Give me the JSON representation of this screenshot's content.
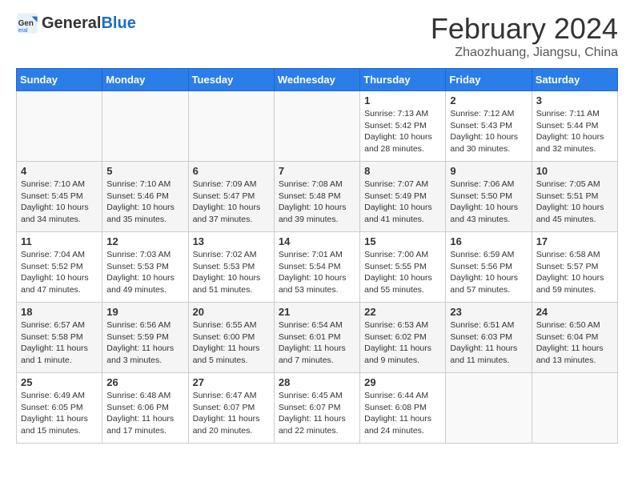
{
  "header": {
    "logo_general": "General",
    "logo_blue": "Blue",
    "month_title": "February 2024",
    "location": "Zhaozhuang, Jiangsu, China"
  },
  "days_of_week": [
    "Sunday",
    "Monday",
    "Tuesday",
    "Wednesday",
    "Thursday",
    "Friday",
    "Saturday"
  ],
  "weeks": [
    [
      {
        "day": "",
        "sunrise": "",
        "sunset": "",
        "daylight": ""
      },
      {
        "day": "",
        "sunrise": "",
        "sunset": "",
        "daylight": ""
      },
      {
        "day": "",
        "sunrise": "",
        "sunset": "",
        "daylight": ""
      },
      {
        "day": "",
        "sunrise": "",
        "sunset": "",
        "daylight": ""
      },
      {
        "day": "1",
        "sunrise": "Sunrise: 7:13 AM",
        "sunset": "Sunset: 5:42 PM",
        "daylight": "Daylight: 10 hours and 28 minutes."
      },
      {
        "day": "2",
        "sunrise": "Sunrise: 7:12 AM",
        "sunset": "Sunset: 5:43 PM",
        "daylight": "Daylight: 10 hours and 30 minutes."
      },
      {
        "day": "3",
        "sunrise": "Sunrise: 7:11 AM",
        "sunset": "Sunset: 5:44 PM",
        "daylight": "Daylight: 10 hours and 32 minutes."
      }
    ],
    [
      {
        "day": "4",
        "sunrise": "Sunrise: 7:10 AM",
        "sunset": "Sunset: 5:45 PM",
        "daylight": "Daylight: 10 hours and 34 minutes."
      },
      {
        "day": "5",
        "sunrise": "Sunrise: 7:10 AM",
        "sunset": "Sunset: 5:46 PM",
        "daylight": "Daylight: 10 hours and 35 minutes."
      },
      {
        "day": "6",
        "sunrise": "Sunrise: 7:09 AM",
        "sunset": "Sunset: 5:47 PM",
        "daylight": "Daylight: 10 hours and 37 minutes."
      },
      {
        "day": "7",
        "sunrise": "Sunrise: 7:08 AM",
        "sunset": "Sunset: 5:48 PM",
        "daylight": "Daylight: 10 hours and 39 minutes."
      },
      {
        "day": "8",
        "sunrise": "Sunrise: 7:07 AM",
        "sunset": "Sunset: 5:49 PM",
        "daylight": "Daylight: 10 hours and 41 minutes."
      },
      {
        "day": "9",
        "sunrise": "Sunrise: 7:06 AM",
        "sunset": "Sunset: 5:50 PM",
        "daylight": "Daylight: 10 hours and 43 minutes."
      },
      {
        "day": "10",
        "sunrise": "Sunrise: 7:05 AM",
        "sunset": "Sunset: 5:51 PM",
        "daylight": "Daylight: 10 hours and 45 minutes."
      }
    ],
    [
      {
        "day": "11",
        "sunrise": "Sunrise: 7:04 AM",
        "sunset": "Sunset: 5:52 PM",
        "daylight": "Daylight: 10 hours and 47 minutes."
      },
      {
        "day": "12",
        "sunrise": "Sunrise: 7:03 AM",
        "sunset": "Sunset: 5:53 PM",
        "daylight": "Daylight: 10 hours and 49 minutes."
      },
      {
        "day": "13",
        "sunrise": "Sunrise: 7:02 AM",
        "sunset": "Sunset: 5:53 PM",
        "daylight": "Daylight: 10 hours and 51 minutes."
      },
      {
        "day": "14",
        "sunrise": "Sunrise: 7:01 AM",
        "sunset": "Sunset: 5:54 PM",
        "daylight": "Daylight: 10 hours and 53 minutes."
      },
      {
        "day": "15",
        "sunrise": "Sunrise: 7:00 AM",
        "sunset": "Sunset: 5:55 PM",
        "daylight": "Daylight: 10 hours and 55 minutes."
      },
      {
        "day": "16",
        "sunrise": "Sunrise: 6:59 AM",
        "sunset": "Sunset: 5:56 PM",
        "daylight": "Daylight: 10 hours and 57 minutes."
      },
      {
        "day": "17",
        "sunrise": "Sunrise: 6:58 AM",
        "sunset": "Sunset: 5:57 PM",
        "daylight": "Daylight: 10 hours and 59 minutes."
      }
    ],
    [
      {
        "day": "18",
        "sunrise": "Sunrise: 6:57 AM",
        "sunset": "Sunset: 5:58 PM",
        "daylight": "Daylight: 11 hours and 1 minute."
      },
      {
        "day": "19",
        "sunrise": "Sunrise: 6:56 AM",
        "sunset": "Sunset: 5:59 PM",
        "daylight": "Daylight: 11 hours and 3 minutes."
      },
      {
        "day": "20",
        "sunrise": "Sunrise: 6:55 AM",
        "sunset": "Sunset: 6:00 PM",
        "daylight": "Daylight: 11 hours and 5 minutes."
      },
      {
        "day": "21",
        "sunrise": "Sunrise: 6:54 AM",
        "sunset": "Sunset: 6:01 PM",
        "daylight": "Daylight: 11 hours and 7 minutes."
      },
      {
        "day": "22",
        "sunrise": "Sunrise: 6:53 AM",
        "sunset": "Sunset: 6:02 PM",
        "daylight": "Daylight: 11 hours and 9 minutes."
      },
      {
        "day": "23",
        "sunrise": "Sunrise: 6:51 AM",
        "sunset": "Sunset: 6:03 PM",
        "daylight": "Daylight: 11 hours and 11 minutes."
      },
      {
        "day": "24",
        "sunrise": "Sunrise: 6:50 AM",
        "sunset": "Sunset: 6:04 PM",
        "daylight": "Daylight: 11 hours and 13 minutes."
      }
    ],
    [
      {
        "day": "25",
        "sunrise": "Sunrise: 6:49 AM",
        "sunset": "Sunset: 6:05 PM",
        "daylight": "Daylight: 11 hours and 15 minutes."
      },
      {
        "day": "26",
        "sunrise": "Sunrise: 6:48 AM",
        "sunset": "Sunset: 6:06 PM",
        "daylight": "Daylight: 11 hours and 17 minutes."
      },
      {
        "day": "27",
        "sunrise": "Sunrise: 6:47 AM",
        "sunset": "Sunset: 6:07 PM",
        "daylight": "Daylight: 11 hours and 20 minutes."
      },
      {
        "day": "28",
        "sunrise": "Sunrise: 6:45 AM",
        "sunset": "Sunset: 6:07 PM",
        "daylight": "Daylight: 11 hours and 22 minutes."
      },
      {
        "day": "29",
        "sunrise": "Sunrise: 6:44 AM",
        "sunset": "Sunset: 6:08 PM",
        "daylight": "Daylight: 11 hours and 24 minutes."
      },
      {
        "day": "",
        "sunrise": "",
        "sunset": "",
        "daylight": ""
      },
      {
        "day": "",
        "sunrise": "",
        "sunset": "",
        "daylight": ""
      }
    ]
  ]
}
